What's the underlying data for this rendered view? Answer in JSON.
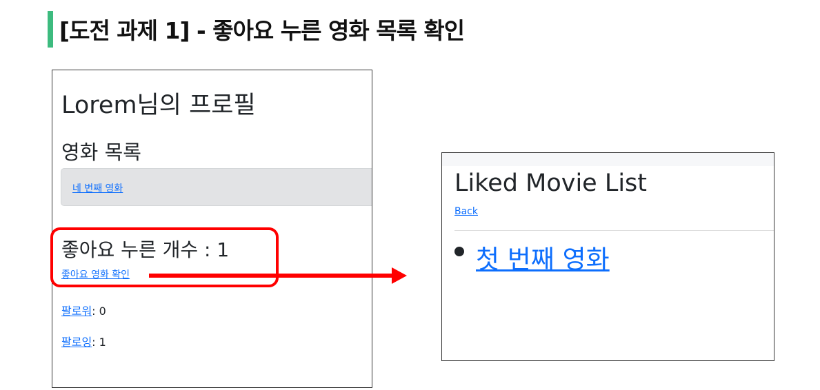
{
  "slide_title": "[도전 과제 1] - 좋아요 누른 영화 목록 확인",
  "profile": {
    "heading": "Lorem님의 프로필",
    "movies_heading": "영화 목록",
    "movie_link": "네 번째 영화",
    "likes_heading": "좋아요 누른 개수 : 1",
    "liked_link": "좋아요 영화 확인",
    "followers_label": "팔로워",
    "followers_value": ": 0",
    "following_label": "팔로잉",
    "following_value": ": 1"
  },
  "liked_page": {
    "heading": "Liked Movie List",
    "back": "Back",
    "items": [
      "첫 번째 영화"
    ]
  },
  "colors": {
    "accent": "#3dbb7f",
    "highlight": "#ff0000",
    "link": "#0d6efd"
  }
}
